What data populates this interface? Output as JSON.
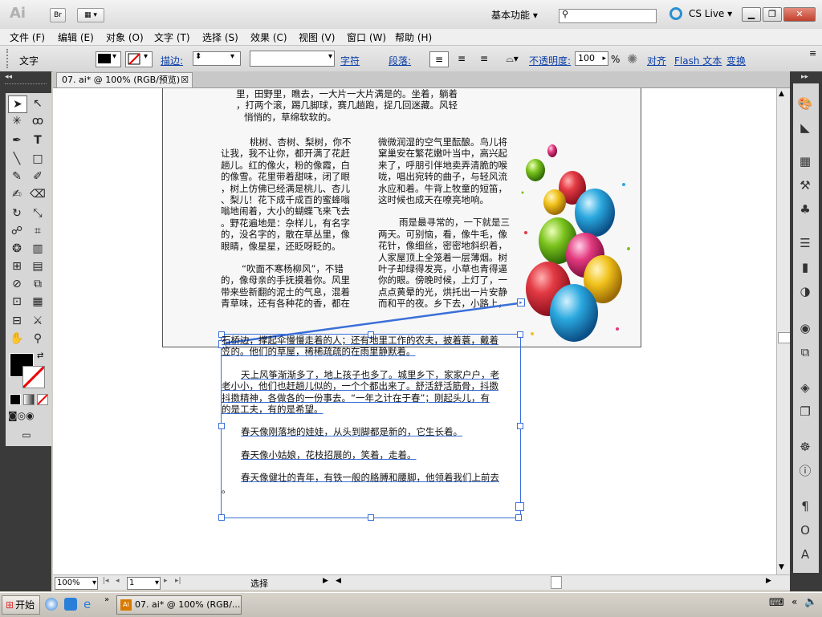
{
  "titlebar": {
    "app_logo": "Ai",
    "bridge_button": "Br",
    "workspace": "基本功能",
    "search_placeholder": "",
    "cs_live": "CS Live",
    "min_glyph": "▁",
    "restore_glyph": "❐",
    "close_glyph": "✕"
  },
  "menu": [
    "文件 (F)",
    "编辑 (E)",
    "对象 (O)",
    "文字 (T)",
    "选择 (S)",
    "效果 (C)",
    "视图 (V)",
    "窗口 (W)",
    "帮助 (H)"
  ],
  "control": {
    "tool_label": "文字",
    "stroke_label": "描边:",
    "char_label": "字符",
    "para_label": "段落:",
    "opacity_label": "不透明度:",
    "opacity_value": "100",
    "opacity_unit": "%",
    "align_label": "对齐",
    "flash_label": "Flash 文本",
    "transform_label": "变换"
  },
  "document": {
    "tab_title": "07. ai* @ 100% (RGB/预览)",
    "close_glyph": "☒"
  },
  "artboard_text": {
    "top_lines": [
      "里，田野里，瞧去，一大片一大片满是的。坐着，躺着",
      "，打两个滚，踢几脚球，赛几趟跑，捉几回迷藏。风轻",
      "悄悄的，草绵软软的。"
    ],
    "col1_para1": [
      "桃树、杏树、梨树，你不",
      "让我，我不让你，都开满了花赶",
      "趟儿。红的像火，粉的像霞，白",
      "的像雪。花里带着甜味，闭了眼",
      "，树上仿佛已经满是桃儿、杏儿",
      "、梨儿！花下成千成百的蜜蜂嗡",
      "嗡地闹着，大小的蝴蝶飞来飞去",
      "。野花遍地是：杂样儿，有名字",
      "的，没名字的，散在草丛里，像",
      "眼睛，像星星，还眨呀眨的。"
    ],
    "col1_para2": [
      "“吹面不寒杨柳风”，不错",
      "的，像母亲的手抚摸着你。风里",
      "带来些新翻的泥土的气息，混着",
      "青草味，还有各种花的香，都在"
    ],
    "col2_para1": [
      "微微润湿的空气里酝酿。鸟儿将",
      "窠巢安在繁花嫩叶当中，高兴起",
      "来了，呼朋引伴地卖弄清脆的喉",
      "咙，唱出宛转的曲子，与轻风流",
      "水应和着。牛背上牧童的短笛，",
      "这时候也成天在嘹亮地响。"
    ],
    "col2_para2": [
      "雨是最寻常的，一下就是三",
      "两天。可别恼，看，像牛毛，像",
      "花针，像细丝，密密地斜织着，",
      "人家屋顶上全笼着一层薄烟。树",
      "叶子却绿得发亮，小草也青得逼",
      "你的眼。傍晚时候，上灯了，一",
      "点点黄晕的光，烘托出一片安静",
      "而和平的夜。乡下去，小路上，"
    ]
  },
  "overflow_text": {
    "para1": [
      "石桥边，撑起伞慢慢走着的人；还有地里工作的农夫，披着蓑，戴着",
      "笠的。他们的草屋，稀稀疏疏的在雨里静默着。"
    ],
    "para2": [
      "天上风筝渐渐多了，地上孩子也多了。城里乡下，家家户户，老",
      "老小小，他们也赶趟儿似的，一个个都出来了。舒活舒活筋骨，抖擞",
      "抖擞精神，各做各的一份事去。“一年之计在于春”；刚起头儿，有",
      "的是工夫，有的是希望。"
    ],
    "para3": "春天像刚落地的娃娃，从头到脚都是新的，它生长着。",
    "para4": "春天像小姑娘，花枝招展的，笑着，走着。",
    "para5": "春天像健壮的青年，有铁一般的胳膊和腰脚，他领着我们上前去",
    "para5_tail": "。"
  },
  "statusbar": {
    "zoom": "100%",
    "page": "1",
    "status": "选择"
  },
  "taskbar": {
    "start": "开始",
    "task_item": "07. ai* @ 100% (RGB/..."
  },
  "colors": {
    "accent_blue": "#3a6fd8",
    "panel_dark": "#3a3a3a"
  }
}
